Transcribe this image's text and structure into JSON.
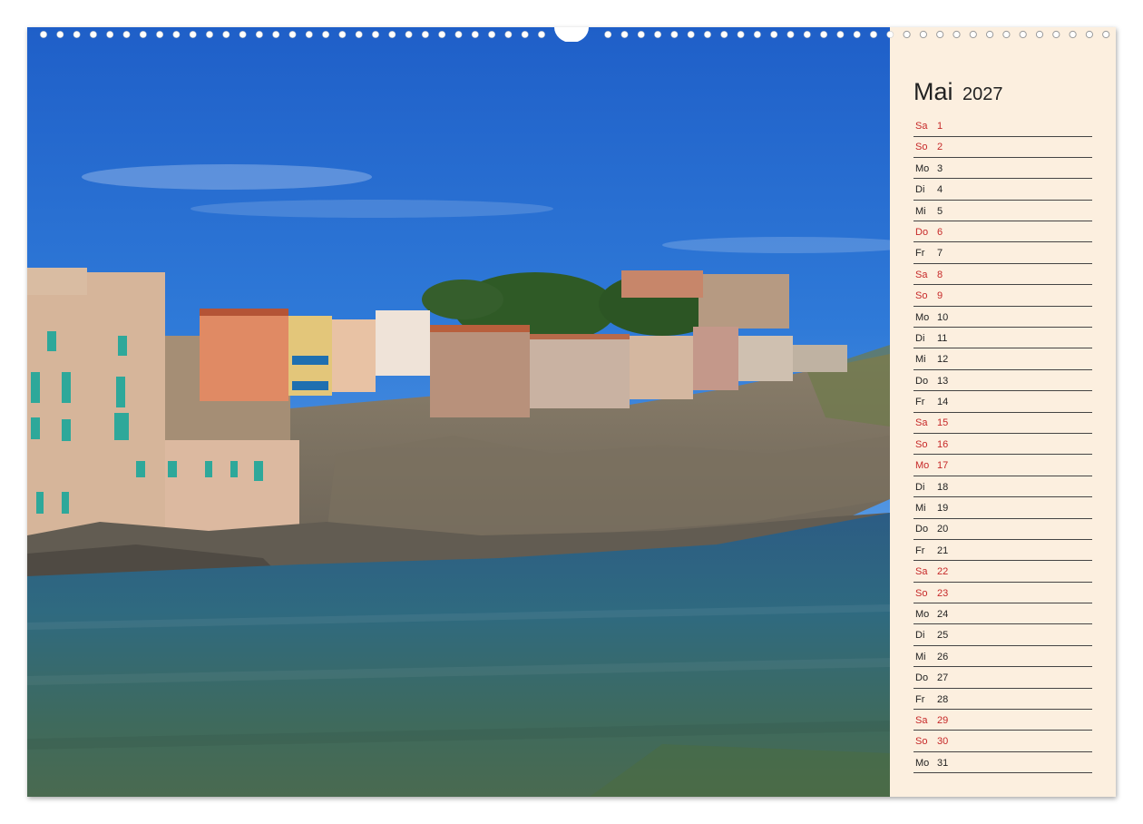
{
  "calendar": {
    "month": "Mai",
    "year": "2027",
    "days": [
      {
        "wd": "Sa",
        "d": "1",
        "weekend": true
      },
      {
        "wd": "So",
        "d": "2",
        "weekend": true
      },
      {
        "wd": "Mo",
        "d": "3",
        "weekend": false
      },
      {
        "wd": "Di",
        "d": "4",
        "weekend": false
      },
      {
        "wd": "Mi",
        "d": "5",
        "weekend": false
      },
      {
        "wd": "Do",
        "d": "6",
        "weekend": true
      },
      {
        "wd": "Fr",
        "d": "7",
        "weekend": false
      },
      {
        "wd": "Sa",
        "d": "8",
        "weekend": true
      },
      {
        "wd": "So",
        "d": "9",
        "weekend": true
      },
      {
        "wd": "Mo",
        "d": "10",
        "weekend": false
      },
      {
        "wd": "Di",
        "d": "11",
        "weekend": false
      },
      {
        "wd": "Mi",
        "d": "12",
        "weekend": false
      },
      {
        "wd": "Do",
        "d": "13",
        "weekend": false
      },
      {
        "wd": "Fr",
        "d": "14",
        "weekend": false
      },
      {
        "wd": "Sa",
        "d": "15",
        "weekend": true
      },
      {
        "wd": "So",
        "d": "16",
        "weekend": true
      },
      {
        "wd": "Mo",
        "d": "17",
        "weekend": true
      },
      {
        "wd": "Di",
        "d": "18",
        "weekend": false
      },
      {
        "wd": "Mi",
        "d": "19",
        "weekend": false
      },
      {
        "wd": "Do",
        "d": "20",
        "weekend": false
      },
      {
        "wd": "Fr",
        "d": "21",
        "weekend": false
      },
      {
        "wd": "Sa",
        "d": "22",
        "weekend": true
      },
      {
        "wd": "So",
        "d": "23",
        "weekend": true
      },
      {
        "wd": "Mo",
        "d": "24",
        "weekend": false
      },
      {
        "wd": "Di",
        "d": "25",
        "weekend": false
      },
      {
        "wd": "Mi",
        "d": "26",
        "weekend": false
      },
      {
        "wd": "Do",
        "d": "27",
        "weekend": false
      },
      {
        "wd": "Fr",
        "d": "28",
        "weekend": false
      },
      {
        "wd": "Sa",
        "d": "29",
        "weekend": true
      },
      {
        "wd": "So",
        "d": "30",
        "weekend": true
      },
      {
        "wd": "Mo",
        "d": "31",
        "weekend": false
      }
    ]
  },
  "colors": {
    "weekend_text": "#c62828",
    "weekday_text": "#222222",
    "panel_bg": "#fcefdf"
  }
}
